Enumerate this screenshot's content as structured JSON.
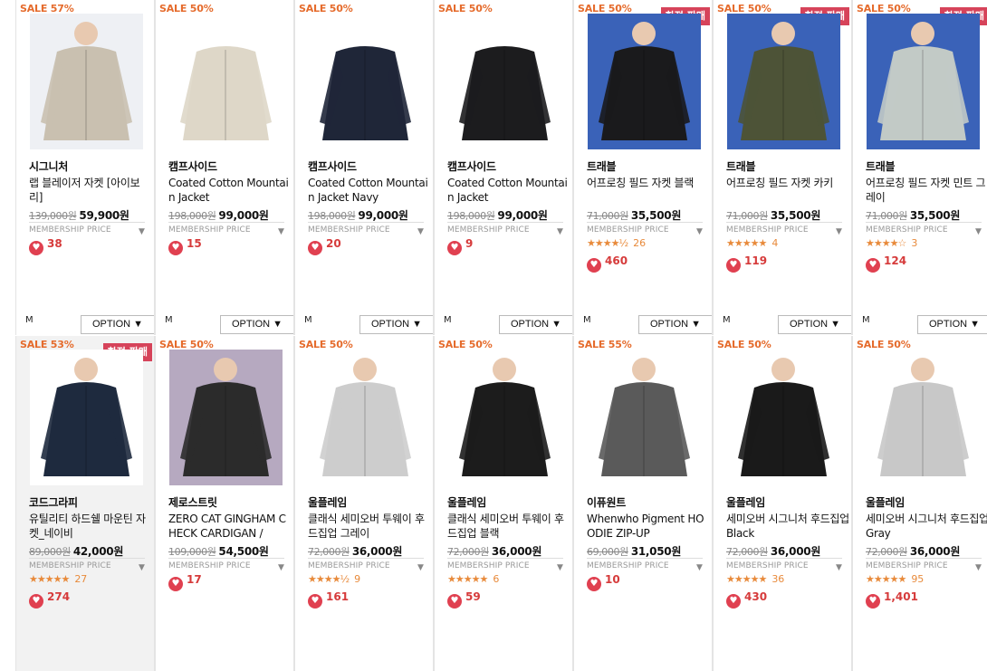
{
  "option_label": "OPTION ▼",
  "membership_label": "MEMBERSHIP PRICE",
  "products": [
    {
      "sale": "SALE 57%",
      "limited": "",
      "brand": "시그니처",
      "name": "랩 블레이저 자켓 [아이보리]",
      "orig": "139,000원",
      "price": "59,900원",
      "stars": "",
      "reviews": "",
      "likes": "38",
      "size": "M",
      "color": "#c9c0b0",
      "bg": "#eef0f4"
    },
    {
      "sale": "SALE 50%",
      "limited": "",
      "brand": "캠프사이드",
      "name": "Coated Cotton Mountain Jacket",
      "orig": "198,000원",
      "price": "99,000원",
      "stars": "",
      "reviews": "",
      "likes": "15",
      "size": "M",
      "color": "#ded7c8",
      "bg": "#ffffff"
    },
    {
      "sale": "SALE 50%",
      "limited": "",
      "brand": "캠프사이드",
      "name": "Coated Cotton Mountain Jacket Navy",
      "orig": "198,000원",
      "price": "99,000원",
      "stars": "",
      "reviews": "",
      "likes": "20",
      "size": "M",
      "color": "#1f2638",
      "bg": "#ffffff"
    },
    {
      "sale": "SALE 50%",
      "limited": "",
      "brand": "캠프사이드",
      "name": "Coated Cotton Mountain Jacket",
      "orig": "198,000원",
      "price": "99,000원",
      "stars": "",
      "reviews": "",
      "likes": "9",
      "size": "M",
      "color": "#1c1c1e",
      "bg": "#ffffff"
    },
    {
      "sale": "SALE 50%",
      "limited": "한정 판매",
      "brand": "트래블",
      "name": "어프로칭 필드 자켓 블랙",
      "orig": "71,000원",
      "price": "35,500원",
      "stars": "★★★★½",
      "reviews": "26",
      "likes": "460",
      "size": "M",
      "color": "#1a1a1c",
      "bg": "#3a62b8"
    },
    {
      "sale": "SALE 50%",
      "limited": "한정 판매",
      "brand": "트래블",
      "name": "어프로칭 필드 자켓 카키",
      "orig": "71,000원",
      "price": "35,500원",
      "stars": "★★★★★",
      "reviews": "4",
      "likes": "119",
      "size": "M",
      "color": "#4d5337",
      "bg": "#3a62b8"
    },
    {
      "sale": "SALE 50%",
      "limited": "한정 판매",
      "brand": "트래블",
      "name": "어프로칭 필드 자켓 민트 그레이",
      "orig": "71,000원",
      "price": "35,500원",
      "stars": "★★★★☆",
      "reviews": "3",
      "likes": "124",
      "size": "M",
      "color": "#c2cac6",
      "bg": "#3a62b8"
    },
    {
      "sale": "SALE 53%",
      "limited": "한정 판매",
      "brand": "코드그라피",
      "name": "유틸리티 하드쉘 마운틴 자켓_네이비",
      "orig": "89,000원",
      "price": "42,000원",
      "stars": "★★★★★",
      "reviews": "27",
      "likes": "274",
      "size": "",
      "color": "#1e2a3e",
      "bg": "#ffffff"
    },
    {
      "sale": "SALE 50%",
      "limited": "",
      "brand": "제로스트릿",
      "name": "ZERO CAT GINGHAM CHECK CARDIGAN /",
      "orig": "109,000원",
      "price": "54,500원",
      "stars": "",
      "reviews": "",
      "likes": "17",
      "size": "",
      "color": "#2b2b2b",
      "bg": "#b6a9c0"
    },
    {
      "sale": "SALE 50%",
      "limited": "",
      "brand": "울플레임",
      "name": "클래식 세미오버 투웨이 후드집업 그레이",
      "orig": "72,000원",
      "price": "36,000원",
      "stars": "★★★★½",
      "reviews": "9",
      "likes": "161",
      "size": "",
      "color": "#cdcdcd",
      "bg": "#ffffff"
    },
    {
      "sale": "SALE 50%",
      "limited": "",
      "brand": "울플레임",
      "name": "클래식 세미오버 투웨이 후드집업 블랙",
      "orig": "72,000원",
      "price": "36,000원",
      "stars": "★★★★★",
      "reviews": "6",
      "likes": "59",
      "size": "",
      "color": "#1c1c1c",
      "bg": "#ffffff"
    },
    {
      "sale": "SALE 55%",
      "limited": "",
      "brand": "이퓨원트",
      "name": "Whenwho Pigment HOODIE ZIP-UP",
      "orig": "69,000원",
      "price": "31,050원",
      "stars": "",
      "reviews": "",
      "likes": "10",
      "size": "",
      "color": "#5a5a5a",
      "bg": "#ffffff"
    },
    {
      "sale": "SALE 50%",
      "limited": "",
      "brand": "울플레임",
      "name": "세미오버 시그니처 후드집업 Black",
      "orig": "72,000원",
      "price": "36,000원",
      "stars": "★★★★★",
      "reviews": "36",
      "likes": "430",
      "size": "",
      "color": "#1a1a1a",
      "bg": "#ffffff"
    },
    {
      "sale": "SALE 50%",
      "limited": "",
      "brand": "울플레임",
      "name": "세미오버 시그니처 후드집업 Gray",
      "orig": "72,000원",
      "price": "36,000원",
      "stars": "★★★★★",
      "reviews": "95",
      "likes": "1,401",
      "size": "",
      "color": "#c8c8c8",
      "bg": "#ffffff"
    }
  ]
}
